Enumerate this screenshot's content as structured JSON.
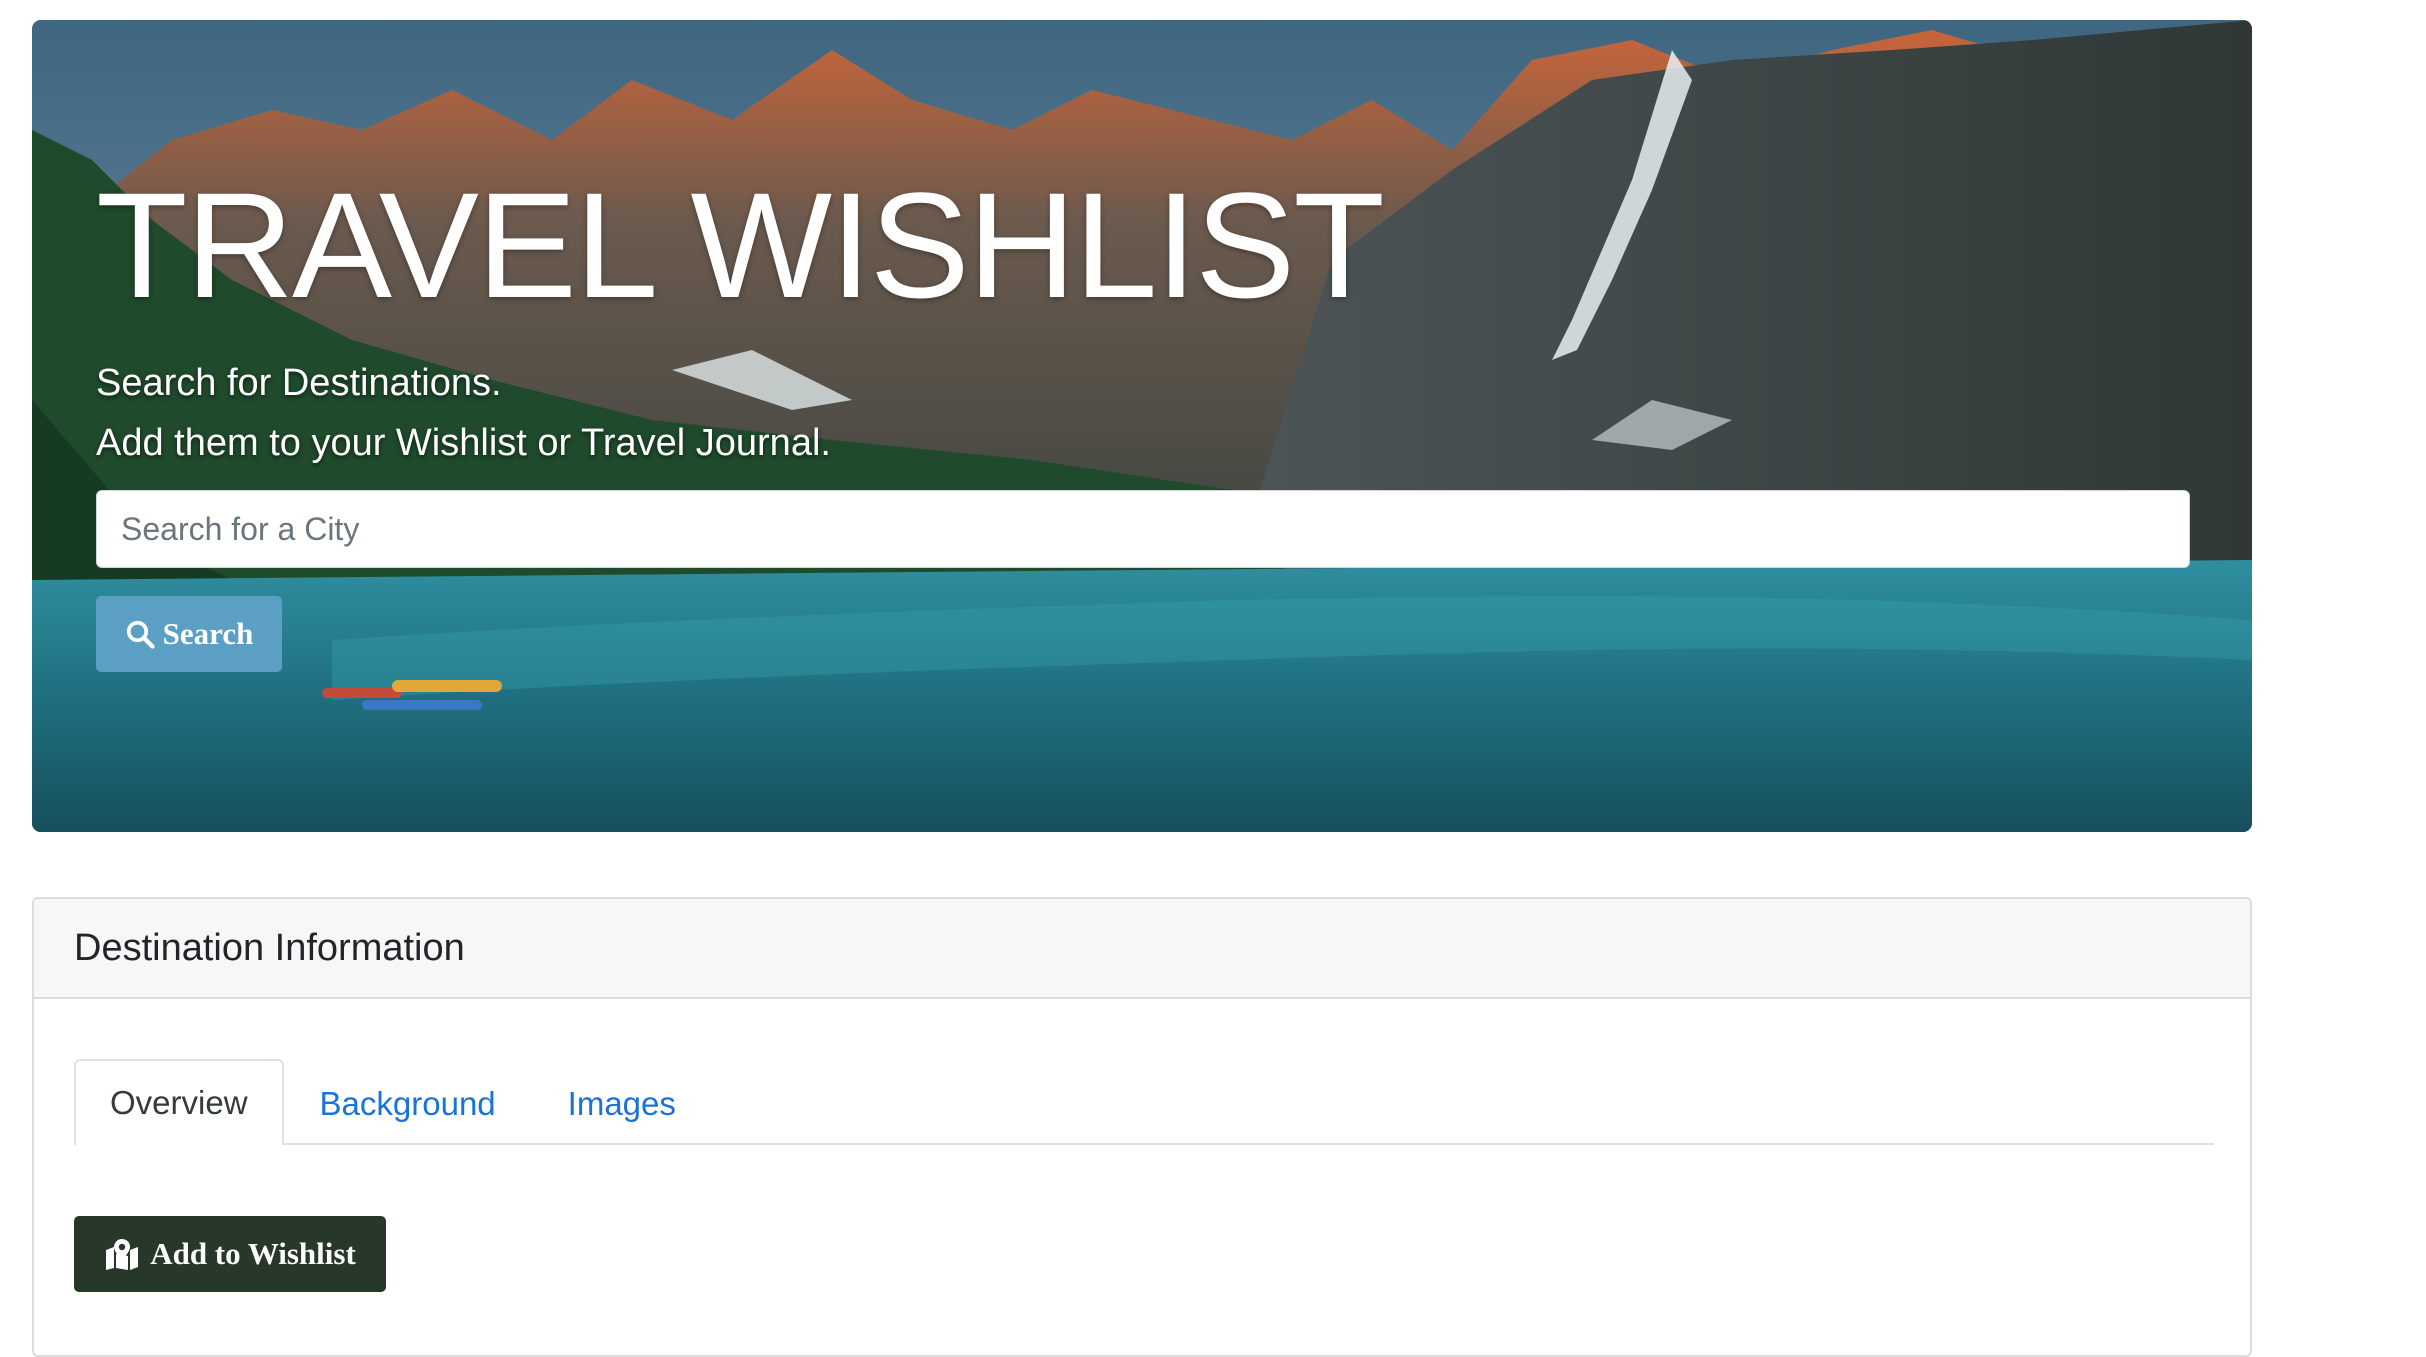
{
  "hero": {
    "title": "TRAVEL WISHLIST",
    "subtitle_line1": "Search for Destinations.",
    "subtitle_line2": "Add them to your Wishlist or Travel Journal.",
    "background_image": "mountain-lake-landscape"
  },
  "search": {
    "placeholder": "Search for a City",
    "value": "",
    "button_label": "Search",
    "button_icon": "magnifying-glass",
    "button_color": "#5b9fc5"
  },
  "destination": {
    "header": "Destination Information",
    "tabs": [
      {
        "label": "Overview",
        "active": true
      },
      {
        "label": "Background",
        "active": false
      },
      {
        "label": "Images",
        "active": false
      }
    ],
    "wishlist_button_label": "Add to Wishlist",
    "wishlist_button_icon": "map-marked",
    "wishlist_button_color": "#27372a"
  },
  "colors": {
    "link": "#1a73d9",
    "card_border": "#dcdcdc",
    "card_header_bg": "#f7f7f7"
  }
}
